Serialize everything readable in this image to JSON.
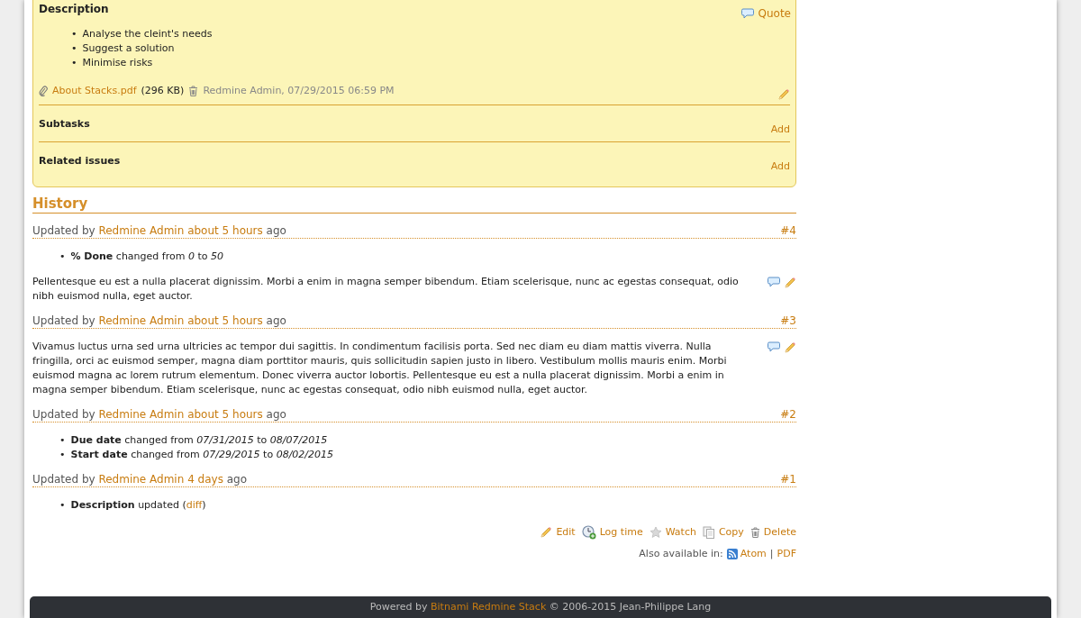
{
  "issue_box": {
    "description": {
      "title": "Description",
      "quote_label": "Quote",
      "items": [
        {
          "bullet": "•",
          "text": "Analyse the cleint's needs"
        },
        {
          "bullet": "•",
          "text": "Suggest a solution"
        },
        {
          "bullet": "•",
          "text": "Minimise risks"
        }
      ],
      "attachment": {
        "filename": "About Stacks.pdf",
        "size": "(296 KB)",
        "meta": "Redmine Admin, 07/29/2015 06:59 PM"
      }
    },
    "sections": [
      {
        "title": "Subtasks",
        "action": "Add"
      },
      {
        "title": "Related issues",
        "action": "Add"
      }
    ]
  },
  "history": {
    "title": "History",
    "journals": [
      {
        "prefix": "Updated by",
        "user": "Redmine Admin",
        "time": "about 5 hours",
        "suffix": "ago",
        "number": "#4",
        "details": [
          {
            "bullet": "•",
            "text": "**% Done** changed from *0* to *50*"
          }
        ],
        "notes": "Pellentesque eu est a nulla placerat dignissim. Morbi a enim in magna semper bibendum. Etiam scelerisque, nunc ac egestas consequat, odio nibh euismod nulla, eget auctor."
      },
      {
        "prefix": "Updated by",
        "user": "Redmine Admin",
        "time": "about 5 hours",
        "suffix": "ago",
        "number": "#3",
        "notes": "Vivamus luctus urna sed urna ultricies ac tempor dui sagittis. In condimentum facilisis porta. Sed nec diam eu diam mattis viverra. Nulla fringilla, orci ac euismod semper, magna diam porttitor mauris, quis sollicitudin sapien justo in libero. Vestibulum mollis mauris enim. Morbi euismod magna ac lorem rutrum elementum. Donec viverra auctor lobortis. Pellentesque eu est a nulla placerat dignissim. Morbi a enim in magna semper bibendum. Etiam scelerisque, nunc ac egestas consequat, odio nibh euismod nulla, eget auctor."
      },
      {
        "prefix": "Updated by",
        "user": "Redmine Admin",
        "time": "about 5 hours",
        "suffix": "ago",
        "number": "#2",
        "details": [
          {
            "bullet": "•",
            "text": "**Due date** changed from *07/31/2015* to *08/07/2015*"
          },
          {
            "bullet": "•",
            "text": "**Start date** changed from *07/29/2015* to *08/02/2015*"
          }
        ]
      },
      {
        "prefix": "Updated by",
        "user": "Redmine Admin",
        "time": "4 days",
        "suffix": "ago",
        "number": "#1",
        "details": [
          {
            "bullet": "•",
            "text": "**Description** updated (",
            "link": "diff",
            "text_after": ")"
          }
        ]
      }
    ]
  },
  "actions": [
    {
      "kind": "edit",
      "label": "Edit"
    },
    {
      "kind": "log",
      "label": "Log time"
    },
    {
      "kind": "watch",
      "label": "Watch"
    },
    {
      "kind": "copy",
      "label": "Copy"
    },
    {
      "kind": "delete",
      "label": "Delete"
    }
  ],
  "formats": {
    "label": "Also available in:",
    "links": [
      "Atom",
      "PDF"
    ],
    "separator": "|"
  },
  "footer": {
    "prefix": "Powered by",
    "link": "Bitnami Redmine Stack",
    "suffix": "© 2006-2015 Jean-Philippe Lang"
  }
}
